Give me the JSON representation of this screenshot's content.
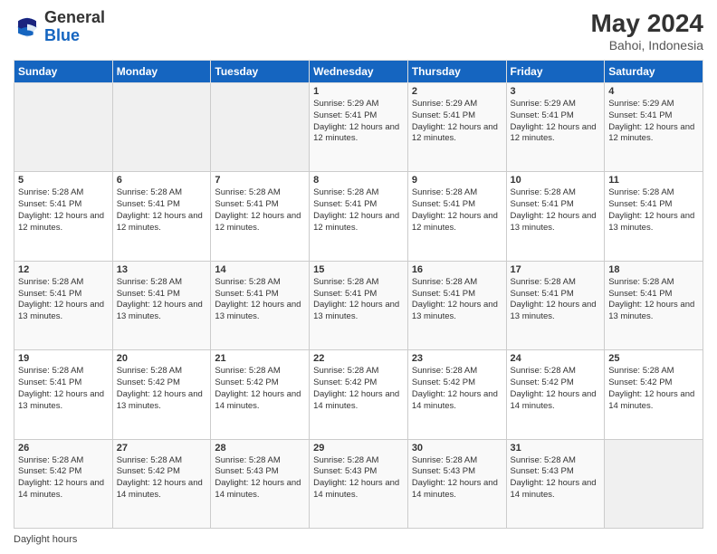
{
  "header": {
    "logo_general": "General",
    "logo_blue": "Blue",
    "title": "May 2024",
    "location": "Bahoi, Indonesia"
  },
  "days_of_week": [
    "Sunday",
    "Monday",
    "Tuesday",
    "Wednesday",
    "Thursday",
    "Friday",
    "Saturday"
  ],
  "footer_text": "Daylight hours",
  "weeks": [
    [
      {
        "day": "",
        "sunrise": "",
        "sunset": "",
        "daylight": "",
        "empty": true
      },
      {
        "day": "",
        "sunrise": "",
        "sunset": "",
        "daylight": "",
        "empty": true
      },
      {
        "day": "",
        "sunrise": "",
        "sunset": "",
        "daylight": "",
        "empty": true
      },
      {
        "day": "1",
        "sunrise": "Sunrise: 5:29 AM",
        "sunset": "Sunset: 5:41 PM",
        "daylight": "Daylight: 12 hours and 12 minutes."
      },
      {
        "day": "2",
        "sunrise": "Sunrise: 5:29 AM",
        "sunset": "Sunset: 5:41 PM",
        "daylight": "Daylight: 12 hours and 12 minutes."
      },
      {
        "day": "3",
        "sunrise": "Sunrise: 5:29 AM",
        "sunset": "Sunset: 5:41 PM",
        "daylight": "Daylight: 12 hours and 12 minutes."
      },
      {
        "day": "4",
        "sunrise": "Sunrise: 5:29 AM",
        "sunset": "Sunset: 5:41 PM",
        "daylight": "Daylight: 12 hours and 12 minutes."
      }
    ],
    [
      {
        "day": "5",
        "sunrise": "Sunrise: 5:28 AM",
        "sunset": "Sunset: 5:41 PM",
        "daylight": "Daylight: 12 hours and 12 minutes."
      },
      {
        "day": "6",
        "sunrise": "Sunrise: 5:28 AM",
        "sunset": "Sunset: 5:41 PM",
        "daylight": "Daylight: 12 hours and 12 minutes."
      },
      {
        "day": "7",
        "sunrise": "Sunrise: 5:28 AM",
        "sunset": "Sunset: 5:41 PM",
        "daylight": "Daylight: 12 hours and 12 minutes."
      },
      {
        "day": "8",
        "sunrise": "Sunrise: 5:28 AM",
        "sunset": "Sunset: 5:41 PM",
        "daylight": "Daylight: 12 hours and 12 minutes."
      },
      {
        "day": "9",
        "sunrise": "Sunrise: 5:28 AM",
        "sunset": "Sunset: 5:41 PM",
        "daylight": "Daylight: 12 hours and 12 minutes."
      },
      {
        "day": "10",
        "sunrise": "Sunrise: 5:28 AM",
        "sunset": "Sunset: 5:41 PM",
        "daylight": "Daylight: 12 hours and 13 minutes."
      },
      {
        "day": "11",
        "sunrise": "Sunrise: 5:28 AM",
        "sunset": "Sunset: 5:41 PM",
        "daylight": "Daylight: 12 hours and 13 minutes."
      }
    ],
    [
      {
        "day": "12",
        "sunrise": "Sunrise: 5:28 AM",
        "sunset": "Sunset: 5:41 PM",
        "daylight": "Daylight: 12 hours and 13 minutes."
      },
      {
        "day": "13",
        "sunrise": "Sunrise: 5:28 AM",
        "sunset": "Sunset: 5:41 PM",
        "daylight": "Daylight: 12 hours and 13 minutes."
      },
      {
        "day": "14",
        "sunrise": "Sunrise: 5:28 AM",
        "sunset": "Sunset: 5:41 PM",
        "daylight": "Daylight: 12 hours and 13 minutes."
      },
      {
        "day": "15",
        "sunrise": "Sunrise: 5:28 AM",
        "sunset": "Sunset: 5:41 PM",
        "daylight": "Daylight: 12 hours and 13 minutes."
      },
      {
        "day": "16",
        "sunrise": "Sunrise: 5:28 AM",
        "sunset": "Sunset: 5:41 PM",
        "daylight": "Daylight: 12 hours and 13 minutes."
      },
      {
        "day": "17",
        "sunrise": "Sunrise: 5:28 AM",
        "sunset": "Sunset: 5:41 PM",
        "daylight": "Daylight: 12 hours and 13 minutes."
      },
      {
        "day": "18",
        "sunrise": "Sunrise: 5:28 AM",
        "sunset": "Sunset: 5:41 PM",
        "daylight": "Daylight: 12 hours and 13 minutes."
      }
    ],
    [
      {
        "day": "19",
        "sunrise": "Sunrise: 5:28 AM",
        "sunset": "Sunset: 5:41 PM",
        "daylight": "Daylight: 12 hours and 13 minutes."
      },
      {
        "day": "20",
        "sunrise": "Sunrise: 5:28 AM",
        "sunset": "Sunset: 5:42 PM",
        "daylight": "Daylight: 12 hours and 13 minutes."
      },
      {
        "day": "21",
        "sunrise": "Sunrise: 5:28 AM",
        "sunset": "Sunset: 5:42 PM",
        "daylight": "Daylight: 12 hours and 14 minutes."
      },
      {
        "day": "22",
        "sunrise": "Sunrise: 5:28 AM",
        "sunset": "Sunset: 5:42 PM",
        "daylight": "Daylight: 12 hours and 14 minutes."
      },
      {
        "day": "23",
        "sunrise": "Sunrise: 5:28 AM",
        "sunset": "Sunset: 5:42 PM",
        "daylight": "Daylight: 12 hours and 14 minutes."
      },
      {
        "day": "24",
        "sunrise": "Sunrise: 5:28 AM",
        "sunset": "Sunset: 5:42 PM",
        "daylight": "Daylight: 12 hours and 14 minutes."
      },
      {
        "day": "25",
        "sunrise": "Sunrise: 5:28 AM",
        "sunset": "Sunset: 5:42 PM",
        "daylight": "Daylight: 12 hours and 14 minutes."
      }
    ],
    [
      {
        "day": "26",
        "sunrise": "Sunrise: 5:28 AM",
        "sunset": "Sunset: 5:42 PM",
        "daylight": "Daylight: 12 hours and 14 minutes."
      },
      {
        "day": "27",
        "sunrise": "Sunrise: 5:28 AM",
        "sunset": "Sunset: 5:42 PM",
        "daylight": "Daylight: 12 hours and 14 minutes."
      },
      {
        "day": "28",
        "sunrise": "Sunrise: 5:28 AM",
        "sunset": "Sunset: 5:43 PM",
        "daylight": "Daylight: 12 hours and 14 minutes."
      },
      {
        "day": "29",
        "sunrise": "Sunrise: 5:28 AM",
        "sunset": "Sunset: 5:43 PM",
        "daylight": "Daylight: 12 hours and 14 minutes."
      },
      {
        "day": "30",
        "sunrise": "Sunrise: 5:28 AM",
        "sunset": "Sunset: 5:43 PM",
        "daylight": "Daylight: 12 hours and 14 minutes."
      },
      {
        "day": "31",
        "sunrise": "Sunrise: 5:28 AM",
        "sunset": "Sunset: 5:43 PM",
        "daylight": "Daylight: 12 hours and 14 minutes."
      },
      {
        "day": "",
        "sunrise": "",
        "sunset": "",
        "daylight": "",
        "empty": true
      }
    ]
  ]
}
